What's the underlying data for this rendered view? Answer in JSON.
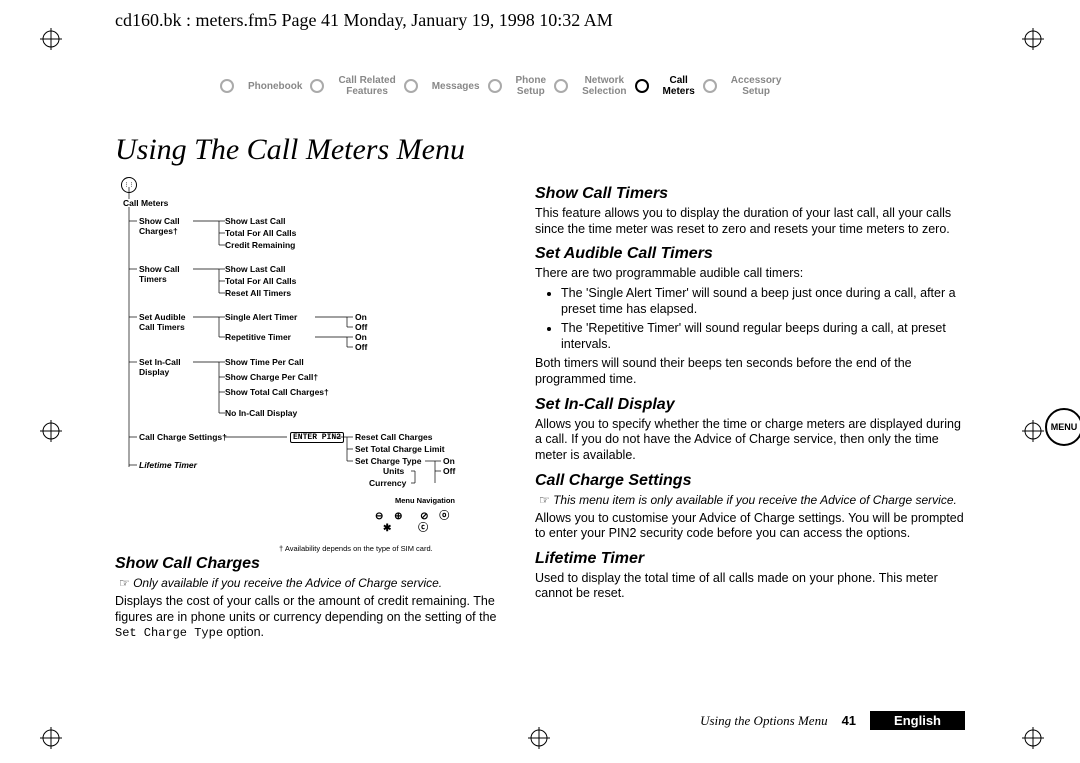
{
  "header_line": "cd160.bk : meters.fm5  Page 41  Monday, January 19, 1998  10:32 AM",
  "nav": [
    {
      "label": "Phonebook",
      "active": false
    },
    {
      "label": "Call Related\nFeatures",
      "active": false
    },
    {
      "label": "Messages",
      "active": false
    },
    {
      "label": "Phone\nSetup",
      "active": false
    },
    {
      "label": "Network\nSelection",
      "active": false
    },
    {
      "label": "Call\nMeters",
      "active": true
    },
    {
      "label": "Accessory\nSetup",
      "active": false
    }
  ],
  "title": "Using The Call Meters Menu",
  "tree": {
    "root": "Call Meters",
    "l1": [
      "Show Call\nCharges†",
      "Show Call\nTimers",
      "Set Audible\nCall Timers",
      "Set In-Call\nDisplay",
      "Call Charge Settings†",
      "Lifetime Timer"
    ],
    "l2_a": [
      "Show Last Call",
      "Total For All Calls",
      "Credit Remaining"
    ],
    "l2_b": [
      "Show Last Call",
      "Total For All Calls",
      "Reset All Timers"
    ],
    "l2_c": [
      "Single Alert Timer",
      "Repetitive Timer"
    ],
    "l2_d": [
      "Show Time Per Call",
      "Show Charge Per Call†",
      "Show Total Call Charges†",
      "No In-Call Display"
    ],
    "l2_e_prefix": "ENTER PIN2",
    "l2_e": [
      "Reset Call Charges",
      "Set Total Charge Limit",
      "Set Charge Type"
    ],
    "l3_onoff": [
      "On",
      "Off"
    ],
    "l3_units": [
      "Units",
      "Currency"
    ],
    "nav_label": "Menu Navigation",
    "footnote": "† Availability depends on the type of SIM card."
  },
  "left": {
    "h": "Show Call Charges",
    "note": "Only available if you receive the Advice of Charge service.",
    "p": "Displays the cost of your calls or the amount of credit remaining. The figures are in phone units or currency depending on the setting of the ",
    "mono": "Set Charge Type",
    "p2": " option."
  },
  "right": {
    "s1": {
      "h": "Show Call Timers",
      "p": "This feature allows you to display the duration of your last call, all your calls since the time meter was reset to zero and resets your time meters to zero."
    },
    "s2": {
      "h": "Set Audible Call Timers",
      "p": "There are two programmable audible call timers:",
      "b1": "The 'Single Alert Timer' will sound a beep just once during a call, after a preset time has elapsed.",
      "b2": "The 'Repetitive Timer' will sound regular beeps during a call, at preset intervals.",
      "p2": "Both timers will sound their beeps ten seconds before the end of the programmed time."
    },
    "s3": {
      "h": "Set In-Call Display",
      "p": "Allows you to specify whether the time or charge meters are displayed during a call. If you do not have the Advice of Charge service, then only the time meter is available."
    },
    "s4": {
      "h": "Call Charge Settings",
      "note": "This menu item is only available if you receive the Advice of Charge service.",
      "p": "Allows you to customise your Advice of Charge settings. You will be prompted to enter your PIN2 security code before you can access the options."
    },
    "s5": {
      "h": "Lifetime Timer",
      "p": "Used to display the total time of all calls made on your phone. This meter cannot be reset."
    }
  },
  "menu_badge": "MENU",
  "footer": {
    "using": "Using the Options Menu",
    "page": "41",
    "lang": "English"
  }
}
